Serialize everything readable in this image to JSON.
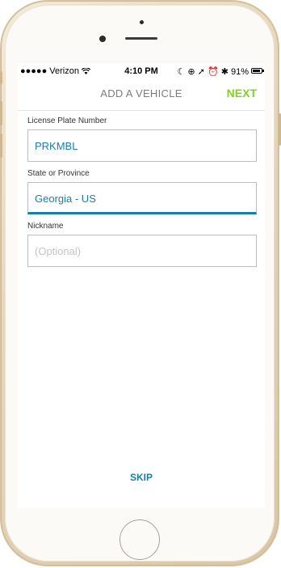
{
  "status_bar": {
    "carrier": "●●●●● Verizon",
    "wifi_icon": "wifi-icon",
    "time": "4:10 PM",
    "right_icons": "☾ ⊕ ➚ ⏰ ✱ 91%",
    "battery_percent": 91
  },
  "navbar": {
    "title": "ADD A VEHICLE",
    "next_label": "NEXT"
  },
  "form": {
    "plate_label": "License Plate Number",
    "plate_value": "PRKMBL",
    "state_label": "State or Province",
    "state_value": "Georgia - US",
    "nickname_label": "Nickname",
    "nickname_placeholder": "(Optional)"
  },
  "skip_label": "SKIP",
  "colors": {
    "accent_blue": "#1a7fa8",
    "next_green": "#7ed321",
    "frame_gold": "#e6d6bb"
  }
}
